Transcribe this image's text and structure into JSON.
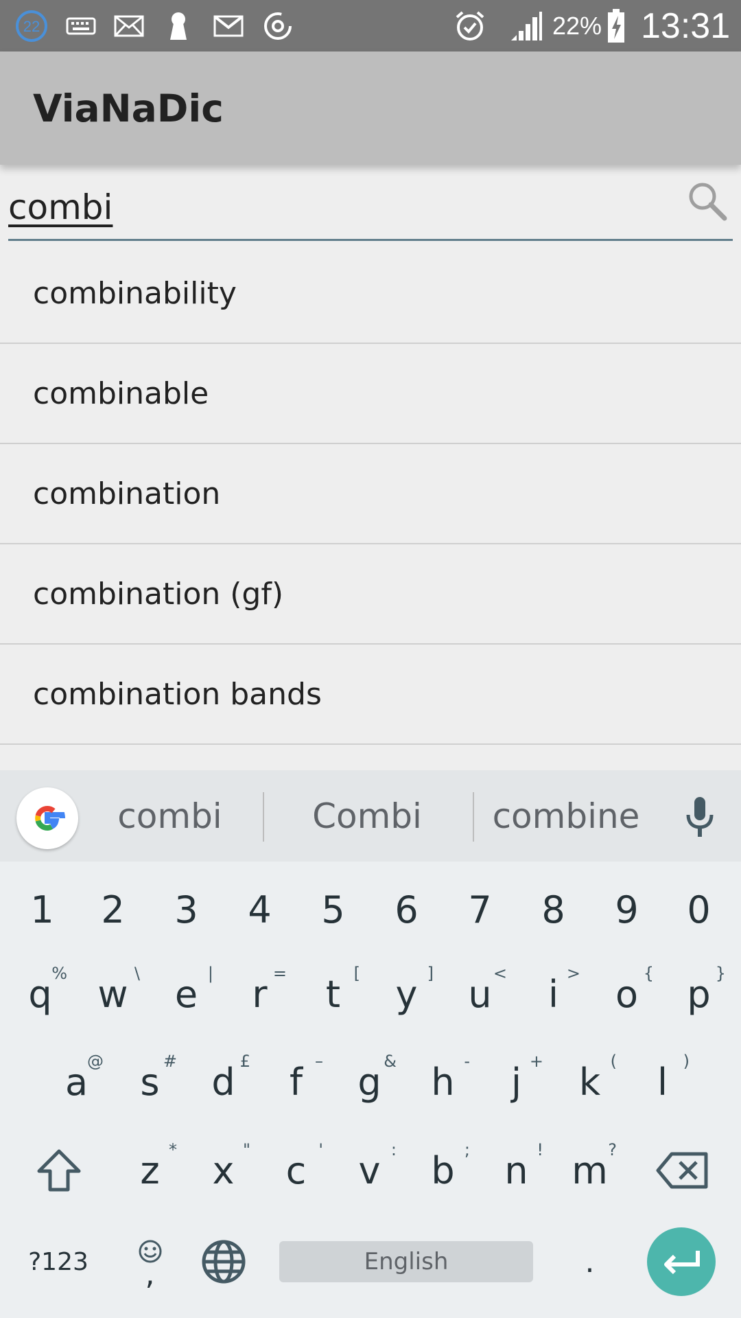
{
  "status_bar": {
    "notification_count": "22",
    "battery_percent": "22%",
    "time": "13:31"
  },
  "app_bar": {
    "title": "ViaNaDic"
  },
  "search": {
    "value": "combi"
  },
  "results": [
    "combinability",
    "combinable",
    "combination",
    "combination (gf)",
    "combination bands"
  ],
  "keyboard": {
    "suggestions": [
      "combi",
      "Combi",
      "combine"
    ],
    "number_row": [
      "1",
      "2",
      "3",
      "4",
      "5",
      "6",
      "7",
      "8",
      "9",
      "0"
    ],
    "row1": [
      {
        "k": "q",
        "h": "%"
      },
      {
        "k": "w",
        "h": "\\"
      },
      {
        "k": "e",
        "h": "|"
      },
      {
        "k": "r",
        "h": "="
      },
      {
        "k": "t",
        "h": "["
      },
      {
        "k": "y",
        "h": "]"
      },
      {
        "k": "u",
        "h": "<"
      },
      {
        "k": "i",
        "h": ">"
      },
      {
        "k": "o",
        "h": "{"
      },
      {
        "k": "p",
        "h": "}"
      }
    ],
    "row2": [
      {
        "k": "a",
        "h": "@"
      },
      {
        "k": "s",
        "h": "#"
      },
      {
        "k": "d",
        "h": "£"
      },
      {
        "k": "f",
        "h": "–"
      },
      {
        "k": "g",
        "h": "&"
      },
      {
        "k": "h",
        "h": "-"
      },
      {
        "k": "j",
        "h": "+"
      },
      {
        "k": "k",
        "h": "("
      },
      {
        "k": "l",
        "h": ")"
      }
    ],
    "row3": [
      {
        "k": "z",
        "h": "*"
      },
      {
        "k": "x",
        "h": "\""
      },
      {
        "k": "c",
        "h": "'"
      },
      {
        "k": "v",
        "h": ":"
      },
      {
        "k": "b",
        "h": ";"
      },
      {
        "k": "n",
        "h": "!"
      },
      {
        "k": "m",
        "h": "?"
      }
    ],
    "symbols_label": "?123",
    "emoji_comma": ",",
    "space_label": "English",
    "period": "."
  },
  "colors": {
    "status_bar": "#757575",
    "app_bar": "#bdbdbd",
    "search_underline": "#607d8b",
    "enter_key": "#4db6ac"
  }
}
